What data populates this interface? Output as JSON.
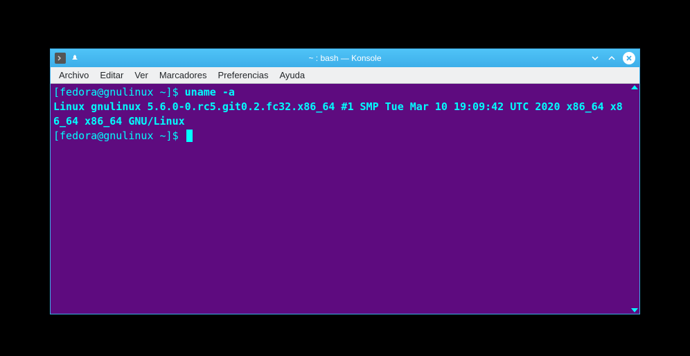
{
  "window": {
    "title": "~ : bash — Konsole"
  },
  "menubar": {
    "items": [
      {
        "label": "Archivo"
      },
      {
        "label": "Editar"
      },
      {
        "label": "Ver"
      },
      {
        "label": "Marcadores"
      },
      {
        "label": "Preferencias"
      },
      {
        "label": "Ayuda"
      }
    ]
  },
  "terminal": {
    "prompt1": "[fedora@gnulinux ~]$ ",
    "command1": "uname -a",
    "output1": "Linux gnulinux 5.6.0-0.rc5.git0.2.fc32.x86_64 #1 SMP Tue Mar 10 19:09:42 UTC 2020 x86_64 x86_64 x86_64 GNU/Linux",
    "prompt2": "[fedora@gnulinux ~]$ "
  }
}
